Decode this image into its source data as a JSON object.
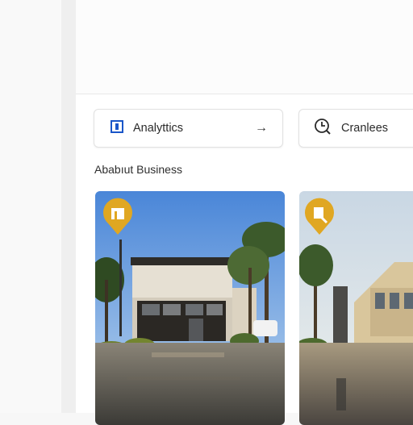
{
  "actions": [
    {
      "label": "Analyttics",
      "icon": "analytics-square-icon",
      "trailing_icon": "arrow-right-icon",
      "trailing_glyph": "→"
    },
    {
      "label": "Cranlees",
      "icon": "clock-search-icon"
    }
  ],
  "section": {
    "heading": "Ababıut Business"
  },
  "listings": [
    {
      "pin_icon": "building-pin-icon",
      "pin_color": "#e0a722"
    },
    {
      "pin_icon": "search-pin-icon",
      "pin_color": "#e0a722"
    }
  ],
  "colors": {
    "accent": "#1a56c8",
    "pin": "#e0a722",
    "card_border": "#e1e1e1"
  }
}
